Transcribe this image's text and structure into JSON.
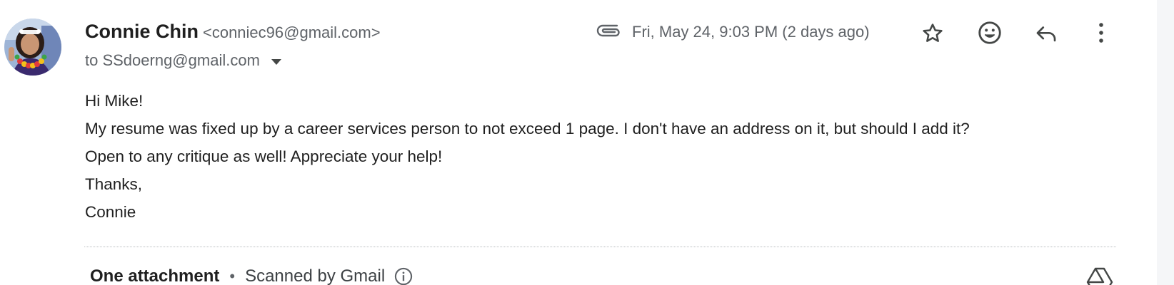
{
  "sender": {
    "name": "Connie Chin",
    "email": "<conniec96@gmail.com>",
    "avatar_icon": "profile-photo"
  },
  "recipient": {
    "label": "to SSdoerng@gmail.com"
  },
  "meta": {
    "timestamp": "Fri, May 24, 9:03 PM (2 days ago)",
    "attachment_icon": "paperclip-icon"
  },
  "actions": {
    "star_icon": "star-icon",
    "emoji_icon": "emoji-reaction-icon",
    "reply_icon": "reply-icon",
    "more_icon": "more-vertical-icon"
  },
  "body": {
    "lines": [
      "Hi Mike!",
      "My resume was fixed up by a career services person to not exceed 1 page. I don't have an address on it, but should I add it?",
      "Open to any critique as well! Appreciate your help!",
      "Thanks,",
      "Connie"
    ]
  },
  "attachments": {
    "count_label": "One attachment",
    "separator": "•",
    "scan_label": "Scanned by Gmail",
    "info_icon": "info-icon",
    "drive_icon": "add-to-drive-icon"
  },
  "colors": {
    "text_primary": "#1f1f1f",
    "text_secondary": "#5f6368",
    "icon": "#444746"
  }
}
